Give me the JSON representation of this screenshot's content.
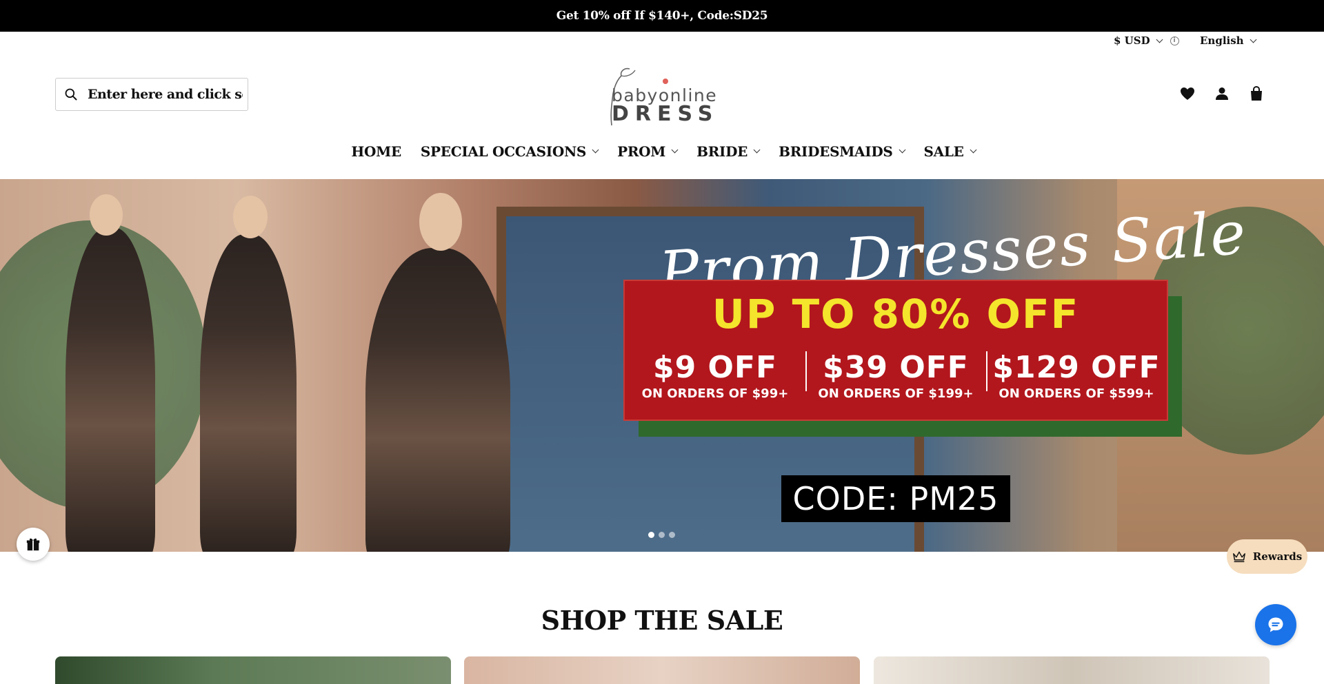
{
  "announcement": {
    "text": "Get 10% off If $140+, Code:SD25"
  },
  "utility": {
    "currency": "$ USD",
    "language": "English"
  },
  "search": {
    "placeholder": "Enter here and click search"
  },
  "logo": {
    "line1": "babyonline",
    "line2": "DRESS"
  },
  "header_icons": [
    "heart-icon",
    "account-icon",
    "shopping-bag-icon"
  ],
  "nav": {
    "items": [
      {
        "label": "HOME",
        "has_dropdown": false
      },
      {
        "label": "SPECIAL OCCASIONS",
        "has_dropdown": true
      },
      {
        "label": "PROM",
        "has_dropdown": true
      },
      {
        "label": "BRIDE",
        "has_dropdown": true
      },
      {
        "label": "BRIDESMAIDS",
        "has_dropdown": true
      },
      {
        "label": "SALE",
        "has_dropdown": true
      }
    ]
  },
  "hero": {
    "script_title": "Prom Dresses Sale",
    "headline": "UP TO 80% OFF",
    "tiers": [
      {
        "amount": "$9 OFF",
        "note": "ON ORDERS OF $99+"
      },
      {
        "amount": "$39 OFF",
        "note": "ON ORDERS OF $199+"
      },
      {
        "amount": "$129 OFF",
        "note": "ON ORDERS OF $599+"
      }
    ],
    "code": "CODE: PM25",
    "slides": 3,
    "active_slide": 1
  },
  "rewards": {
    "label": "Rewards"
  },
  "section": {
    "title": "SHOP THE SALE"
  },
  "colors": {
    "announcement_bg": "#000000",
    "offer_red": "#b3171e",
    "offer_yellow": "#f5e42c",
    "rewards_bg": "#f6ddbd",
    "chat_blue": "#1a73e8"
  }
}
